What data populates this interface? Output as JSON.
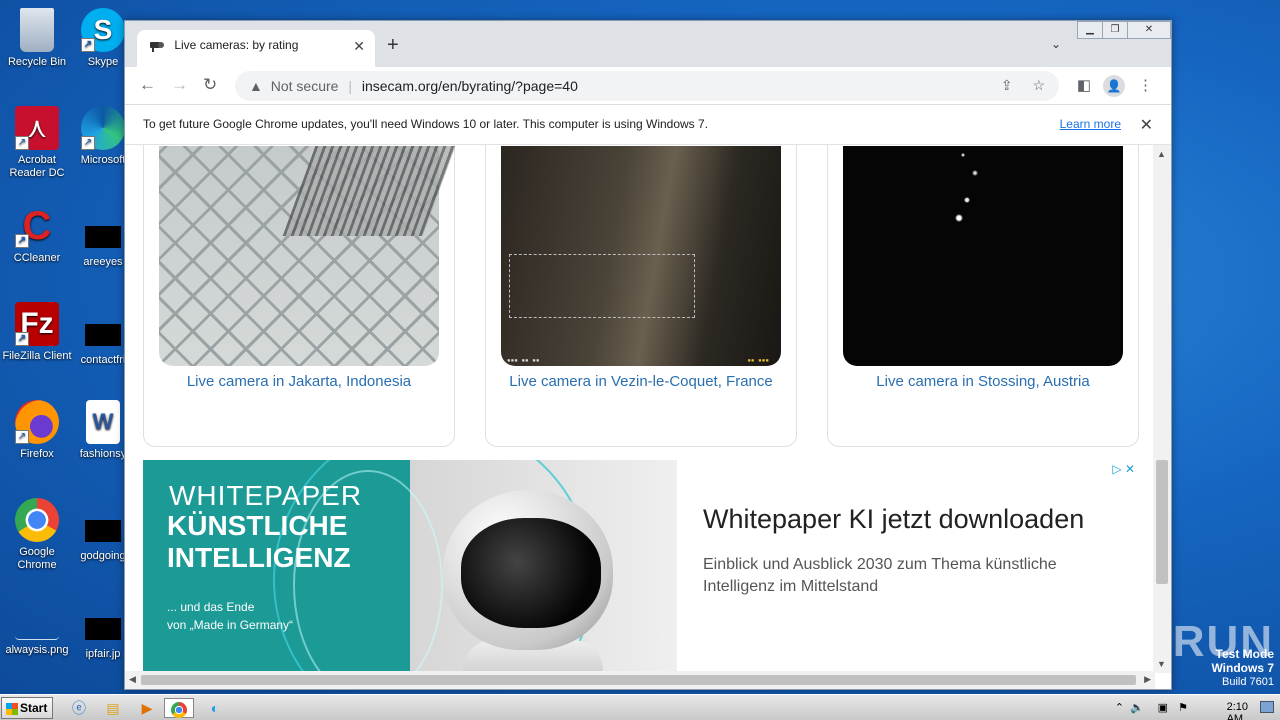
{
  "desktop": {
    "icons_left": [
      "Recycle Bin",
      "Acrobat Reader DC",
      "CCleaner",
      "FileZilla Client",
      "Firefox",
      "Google Chrome",
      "alwaysis.png"
    ],
    "icons_right": [
      "Skype",
      "Microsoft",
      "areeyes",
      "contactfri",
      "fashionsy",
      "godgoing",
      "ipfair.jp"
    ]
  },
  "browser": {
    "tab_title": "Live cameras: by rating",
    "omnibox": {
      "security_label": "Not secure",
      "url": "insecam.org/en/byrating/?page=40"
    },
    "infobar": {
      "message": "To get future Google Chrome updates, you'll need Windows 10 or later. This computer is using Windows 7.",
      "learn_more": "Learn more"
    }
  },
  "cameras": [
    {
      "link": "Live camera in Jakarta, Indonesia"
    },
    {
      "link": "Live camera in Vezin-le-Coquet, France"
    },
    {
      "link": "Live camera in Stossing, Austria"
    }
  ],
  "ad": {
    "image_line1": "WHITEPAPER",
    "image_line2": "KÜNSTLICHE INTELLIGENZ",
    "image_line3a": "... und das Ende",
    "image_line3b": "von „Made in Germany“",
    "headline": "Whitepaper KI jetzt downloaden",
    "body": "Einblick und Ausblick 2030 zum Thema künstliche Intelligenz im Mittelstand"
  },
  "watermark": "ANY▷RUN",
  "test_mode": {
    "line1": "Test Mode",
    "line2": "Windows 7",
    "line3": "Build 7601"
  },
  "taskbar": {
    "start_label": "Start",
    "clock": "2:10 AM"
  },
  "colors": {
    "link": "#2a6fb0",
    "ad_teal": "#1b9a96",
    "desktop_blue": "#1565c0"
  }
}
